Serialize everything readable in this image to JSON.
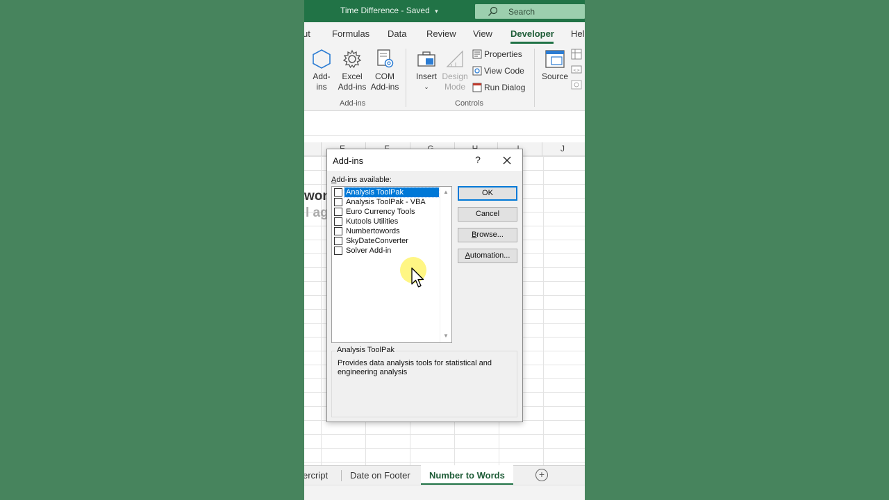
{
  "title_bar": {
    "doc_title": "Time Difference",
    "status": "Saved",
    "search_placeholder": "Search"
  },
  "ribbon_tabs": [
    {
      "label": "ut"
    },
    {
      "label": "Formulas"
    },
    {
      "label": "Data"
    },
    {
      "label": "Review"
    },
    {
      "label": "View"
    },
    {
      "label": "Developer",
      "active": true
    },
    {
      "label": "Hel"
    }
  ],
  "ribbon": {
    "addins_group": {
      "label": "Add-ins",
      "add_ins_line1": "Add-",
      "add_ins_line2": "ins",
      "excel_line1": "Excel",
      "excel_line2": "Add-ins",
      "com_line1": "COM",
      "com_line2": "Add-ins"
    },
    "controls_group": {
      "label": "Controls",
      "insert": "Insert",
      "design_line1": "Design",
      "design_line2": "Mode",
      "properties": "Properties",
      "view_code": "View Code",
      "run_dialog": "Run Dialog"
    },
    "source": "Source"
  },
  "columns": [
    "E",
    "F",
    "G",
    "H",
    "I",
    "J"
  ],
  "cells": {
    "text1": "wor",
    "text2": "l ag"
  },
  "sheet_tabs": [
    {
      "label": "ercript"
    },
    {
      "label": "Date on Footer"
    },
    {
      "label": "Number to Words",
      "active": true
    }
  ],
  "dialog": {
    "title": "Add-ins",
    "help": "?",
    "available_label_underlined": "A",
    "available_label_rest": "dd-ins available:",
    "items": [
      {
        "label": "Analysis ToolPak",
        "checked": false,
        "selected": true
      },
      {
        "label": "Analysis ToolPak - VBA",
        "checked": false
      },
      {
        "label": "Euro Currency Tools",
        "checked": false
      },
      {
        "label": "Kutools Utilities",
        "checked": false
      },
      {
        "label": "Numbertowords",
        "checked": false
      },
      {
        "label": "SkyDateConverter",
        "checked": false
      },
      {
        "label": "Solver Add-in",
        "checked": false
      }
    ],
    "ok": "OK",
    "cancel": "Cancel",
    "browse_u": "B",
    "browse_rest": "rowse...",
    "automation_u": "A",
    "automation_rest": "utomation...",
    "desc_title": "Analysis ToolPak",
    "desc_text": "Provides data analysis tools for statistical and engineering analysis"
  },
  "colors": {
    "excel_green": "#217346",
    "background": "#47845d",
    "selection": "#0078d7"
  }
}
